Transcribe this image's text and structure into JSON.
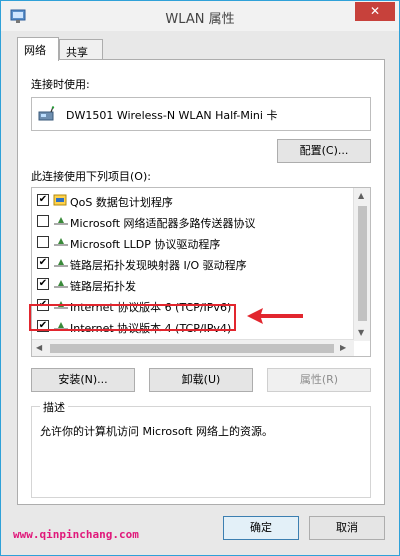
{
  "window": {
    "title": "WLAN 属性",
    "close_glyph": "✕"
  },
  "tabs": [
    {
      "label": "网络"
    },
    {
      "label": "共享"
    }
  ],
  "connect_using": {
    "label": "连接时使用:",
    "device_name": "DW1501 Wireless-N WLAN Half-Mini 卡",
    "configure_label": "配置(C)..."
  },
  "items_section": {
    "label": "此连接使用下列项目(O):",
    "items": [
      {
        "label": "QoS 数据包计划程序",
        "checked": true
      },
      {
        "label": "Microsoft 网络适配器多路传送器协议",
        "checked": false
      },
      {
        "label": "Microsoft LLDP 协议驱动程序",
        "checked": false
      },
      {
        "label": "链路层拓扑发现映射器 I/O 驱动程序",
        "checked": true
      },
      {
        "label": "链路层拓扑发",
        "checked": true
      },
      {
        "label": "Internet 协议版本 6 (TCP/IPv6)",
        "checked": true
      },
      {
        "label": "Internet 协议版本 4 (TCP/IPv4)",
        "checked": true
      }
    ],
    "check_glyph": "✔"
  },
  "actions": {
    "install_label": "安装(N)...",
    "uninstall_label": "卸载(U)",
    "properties_label": "属性(R)"
  },
  "description": {
    "title": "描述",
    "text": "允许你的计算机访问 Microsoft 网络上的资源。"
  },
  "footer": {
    "ok_label": "确定",
    "cancel_label": "取消",
    "watermark": "www.qinpinchang.com"
  },
  "colors": {
    "highlight": "#e2262e",
    "watermark": "#e0187a",
    "title_bar_border": "#2fa1d8",
    "close_button": "#c7413b"
  }
}
